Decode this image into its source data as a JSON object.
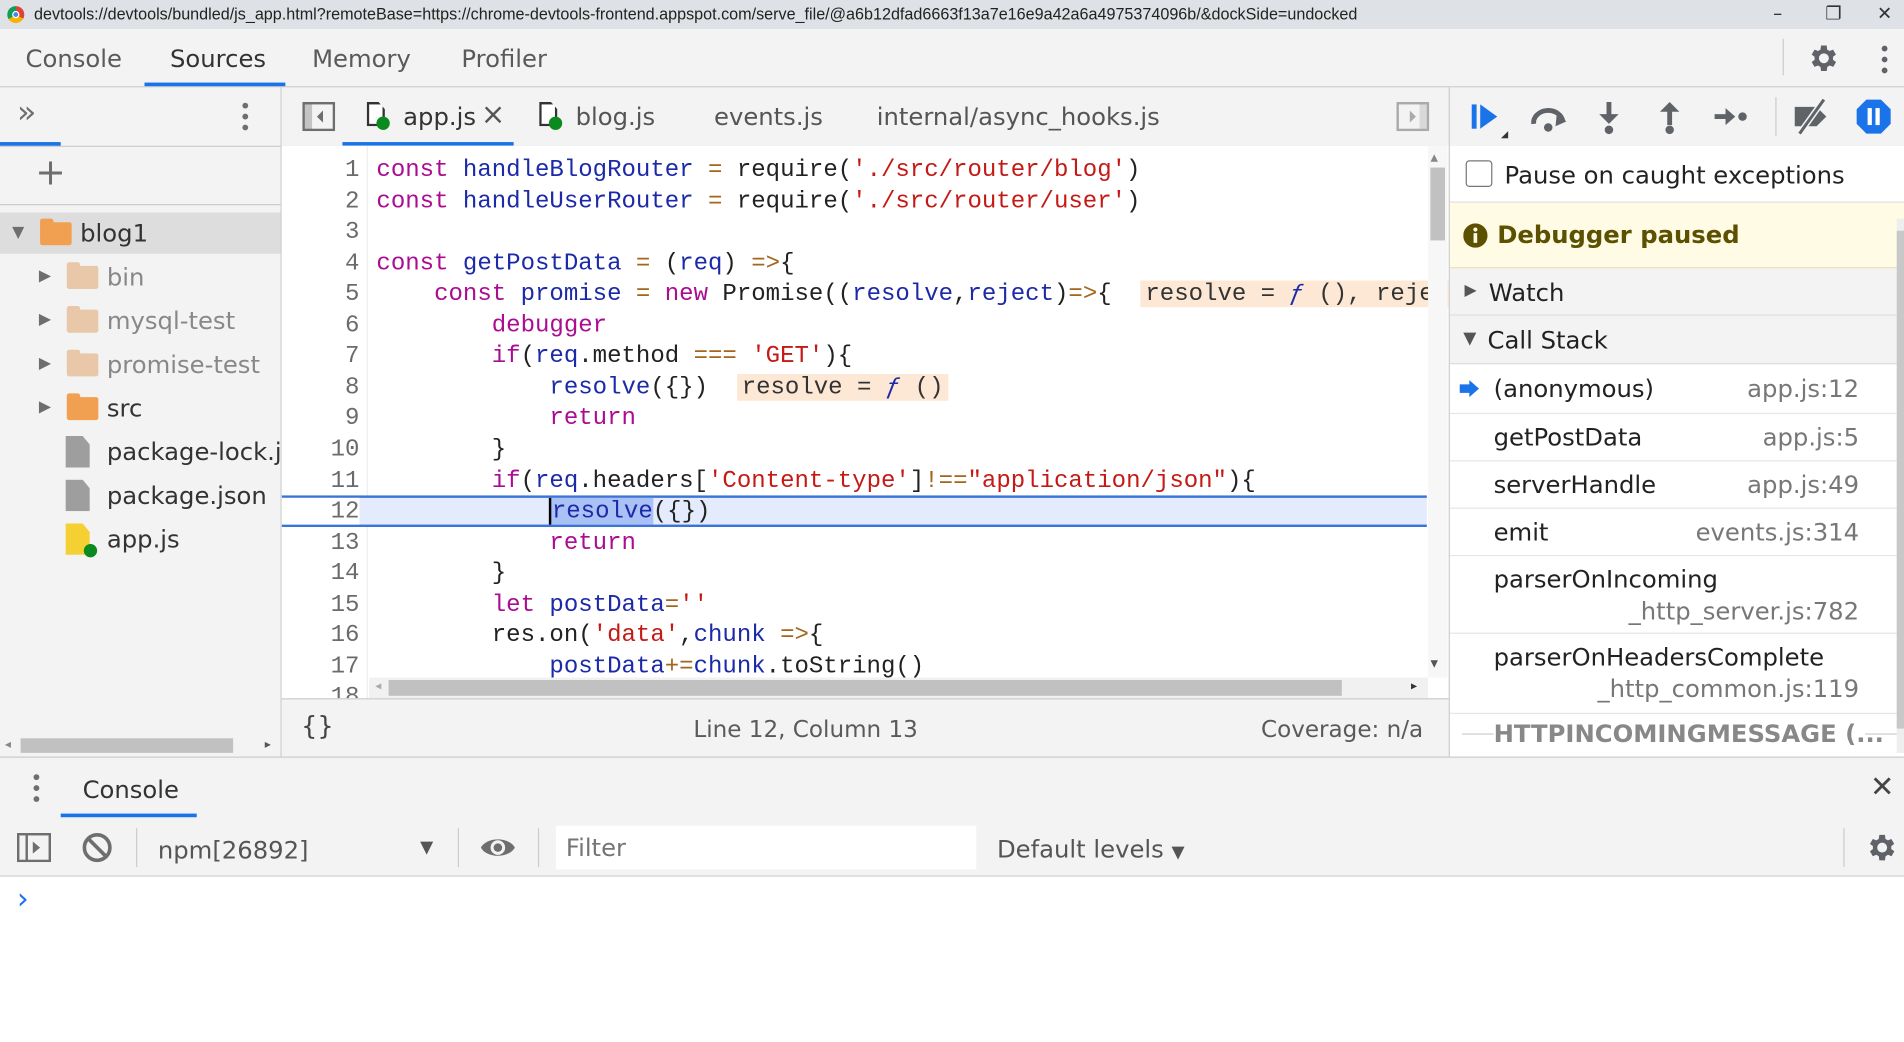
{
  "window": {
    "title": "devtools://devtools/bundled/js_app.html?remoteBase=https://chrome-devtools-frontend.appspot.com/serve_file/@a6b12dfad6663f13a7e16e9a42a6a4975374096b/&dockSide=undocked",
    "minimize": "–",
    "restore": "❐",
    "close": "✕"
  },
  "main_tabs": [
    {
      "label": "Console"
    },
    {
      "label": "Sources",
      "active": true
    },
    {
      "label": "Memory"
    },
    {
      "label": "Profiler"
    }
  ],
  "navigator": {
    "more_tabs": "»",
    "add": "+",
    "tree": [
      {
        "label": "blog1",
        "type": "folder",
        "expanded": true,
        "selected": true,
        "level": 0
      },
      {
        "label": "bin",
        "type": "folder",
        "level": 1
      },
      {
        "label": "mysql-test",
        "type": "folder",
        "level": 1
      },
      {
        "label": "promise-test",
        "type": "folder",
        "level": 1
      },
      {
        "label": "src",
        "type": "folder",
        "level": 1,
        "active": true
      },
      {
        "label": "package-lock.json",
        "type": "file",
        "level": 1
      },
      {
        "label": "package.json",
        "type": "file",
        "level": 1
      },
      {
        "label": "app.js",
        "type": "jsfile",
        "level": 1
      }
    ]
  },
  "editor": {
    "tabs": [
      {
        "label": "app.js",
        "active": true,
        "closable": true,
        "close": "×",
        "icon": "file-running"
      },
      {
        "label": "blog.js",
        "icon": "file-running"
      },
      {
        "label": "events.js"
      },
      {
        "label": "internal/async_hooks.js"
      }
    ],
    "execution_line": 12,
    "lines": [
      [
        [
          "k",
          "const "
        ],
        [
          "v",
          "handleBlogRouter "
        ],
        [
          "o",
          "= "
        ],
        [
          "p",
          "require("
        ],
        [
          "s",
          "'./src/router/blog'"
        ],
        [
          "p",
          ")"
        ]
      ],
      [
        [
          "k",
          "const "
        ],
        [
          "v",
          "handleUserRouter "
        ],
        [
          "o",
          "= "
        ],
        [
          "p",
          "require("
        ],
        [
          "s",
          "'./src/router/user'"
        ],
        [
          "p",
          ")"
        ]
      ],
      [],
      [
        [
          "k",
          "const "
        ],
        [
          "v",
          "getPostData "
        ],
        [
          "o",
          "= "
        ],
        [
          "p",
          "("
        ],
        [
          "v",
          "req"
        ],
        [
          "p",
          ") "
        ],
        [
          "o",
          "=>"
        ],
        [
          "p",
          "{"
        ]
      ],
      [
        [
          "p",
          "    "
        ],
        [
          "k",
          "const "
        ],
        [
          "v",
          "promise "
        ],
        [
          "o",
          "= "
        ],
        [
          "k",
          "new "
        ],
        [
          "p",
          "Promise(("
        ],
        [
          "v",
          "resolve"
        ],
        [
          "p",
          ","
        ],
        [
          "v",
          "reject"
        ],
        [
          "p",
          ")"
        ],
        [
          "o",
          "=>"
        ],
        [
          "p",
          "{  "
        ],
        [
          "inl",
          "resolve = |ƒ| (), reject = ƒ ()"
        ]
      ],
      [
        [
          "p",
          "        "
        ],
        [
          "k",
          "debugger"
        ]
      ],
      [
        [
          "p",
          "        "
        ],
        [
          "k",
          "if"
        ],
        [
          "p",
          "("
        ],
        [
          "v",
          "req"
        ],
        [
          "p",
          ".method "
        ],
        [
          "o",
          "=== "
        ],
        [
          "s",
          "'GET'"
        ],
        [
          "p",
          "){"
        ]
      ],
      [
        [
          "p",
          "            "
        ],
        [
          "v",
          "resolve"
        ],
        [
          "p",
          "({})  "
        ],
        [
          "inl",
          "resolve = |ƒ| ()"
        ]
      ],
      [
        [
          "p",
          "            "
        ],
        [
          "k",
          "return"
        ]
      ],
      [
        [
          "p",
          "        }"
        ]
      ],
      [
        [
          "p",
          "        "
        ],
        [
          "k",
          "if"
        ],
        [
          "p",
          "("
        ],
        [
          "v",
          "req"
        ],
        [
          "p",
          ".headers["
        ],
        [
          "s",
          "'Content-type'"
        ],
        [
          "p",
          "]"
        ],
        [
          "o",
          "!=="
        ],
        [
          "s",
          "\"application/json\""
        ],
        [
          "p",
          "){"
        ]
      ],
      [
        [
          "p",
          "            "
        ],
        [
          "sel",
          "resolve"
        ],
        [
          "p",
          "({})"
        ]
      ],
      [
        [
          "p",
          "            "
        ],
        [
          "k",
          "return"
        ]
      ],
      [
        [
          "p",
          "        }"
        ]
      ],
      [
        [
          "p",
          "        "
        ],
        [
          "k",
          "let "
        ],
        [
          "v",
          "postData"
        ],
        [
          "o",
          "="
        ],
        [
          "s",
          "''"
        ]
      ],
      [
        [
          "p",
          "        res.on("
        ],
        [
          "s",
          "'data'"
        ],
        [
          "p",
          ","
        ],
        [
          "v",
          "chunk "
        ],
        [
          "o",
          "=>"
        ],
        [
          "p",
          "{"
        ]
      ],
      [
        [
          "p",
          "            "
        ],
        [
          "v",
          "postData"
        ],
        [
          "o",
          "+="
        ],
        [
          "v",
          "chunk"
        ],
        [
          "p",
          ".toString()"
        ]
      ],
      []
    ],
    "format_button": "{}",
    "cursor_position": "Line 12, Column 13",
    "coverage": "Coverage: n/a"
  },
  "debugger": {
    "pause_on_caught": {
      "label": "Pause on caught exceptions",
      "checked": false
    },
    "status": "Debugger paused",
    "watch": "Watch",
    "call_stack_title": "Call Stack",
    "call_stack": [
      {
        "name": "(anonymous)",
        "location": "app.js:12",
        "current": true
      },
      {
        "name": "getPostData",
        "location": "app.js:5"
      },
      {
        "name": "serverHandle",
        "location": "app.js:49"
      },
      {
        "name": "emit",
        "location": "events.js:314"
      },
      {
        "name": "parserOnIncoming",
        "location": "_http_server.js:782"
      },
      {
        "name": "parserOnHeadersComplete",
        "location": "_http_common.js:119"
      }
    ],
    "async_divider": "HTTPINCOMINGMESSAGE (..."
  },
  "drawer": {
    "tab": "Console",
    "close": "✕",
    "context": "npm[26892]",
    "filter_placeholder": "Filter",
    "levels": "Default levels",
    "prompt": "›"
  },
  "colors": {
    "accent": "#1a73e8",
    "keyword": "#aa0d91",
    "variable": "#1c2aa8",
    "string": "#c41a16",
    "paused_bg": "#fffbe5",
    "exec_line_bg": "#e3ebfd",
    "folder": "#f0a050"
  }
}
